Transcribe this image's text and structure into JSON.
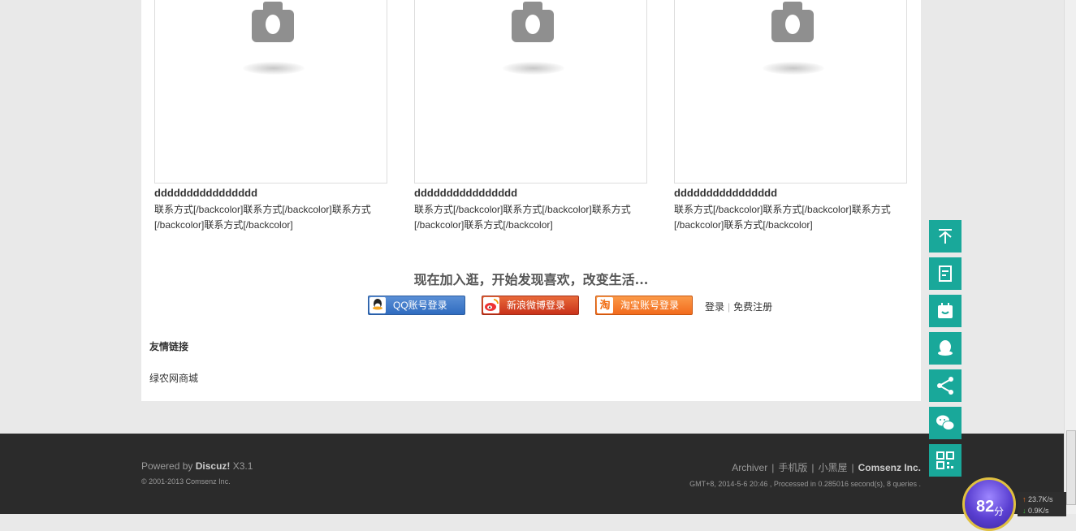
{
  "cards": [
    {
      "title": "dddddddddddddddd",
      "desc_line1": "联系方式[/backcolor]联系方式[/backcolor]联系方式",
      "desc_line2": "[/backcolor]联系方式[/backcolor]"
    },
    {
      "title": "dddddddddddddddd",
      "desc_line1": "联系方式[/backcolor]联系方式[/backcolor]联系方式",
      "desc_line2": "[/backcolor]联系方式[/backcolor]"
    },
    {
      "title": "dddddddddddddddd",
      "desc_line1": "联系方式[/backcolor]联系方式[/backcolor]联系方式",
      "desc_line2": "[/backcolor]联系方式[/backcolor]"
    }
  ],
  "join": {
    "slogan": "现在加入逛，开始发现喜欢，改变生活..."
  },
  "login": {
    "qq_label": "QQ账号登录",
    "weibo_label": "新浪微博登录",
    "taobao_label": "淘宝账号登录",
    "taobao_icon_text": "淘",
    "login_link": "登录",
    "register_link": "免费注册"
  },
  "friends": {
    "title": "友情链接",
    "links": [
      "绿农网商城"
    ]
  },
  "footer": {
    "powered_prefix": "Powered by",
    "powered_brand": "Discuz!",
    "powered_version": "X3.1",
    "copyright": "© 2001-2013 Comsenz Inc.",
    "links": [
      "Archiver",
      "手机版",
      "小黑屋"
    ],
    "company": "Comsenz Inc.",
    "meta": "GMT+8, 2014-5-6 20:46 , Processed in 0.285016 second(s), 8 queries ."
  },
  "side_tools": [
    "back-to-top-icon",
    "post-icon",
    "checkin-icon",
    "qq-icon",
    "share-icon",
    "wechat-icon",
    "qrcode-icon"
  ],
  "widget": {
    "score": "82",
    "score_unit": "分",
    "upload": "23.7K/s",
    "download": "0.9K/s"
  },
  "colors": {
    "tool_bg": "#19a89a",
    "footer_bg": "#2b2b2b",
    "page_bg": "#e9e9e9"
  }
}
